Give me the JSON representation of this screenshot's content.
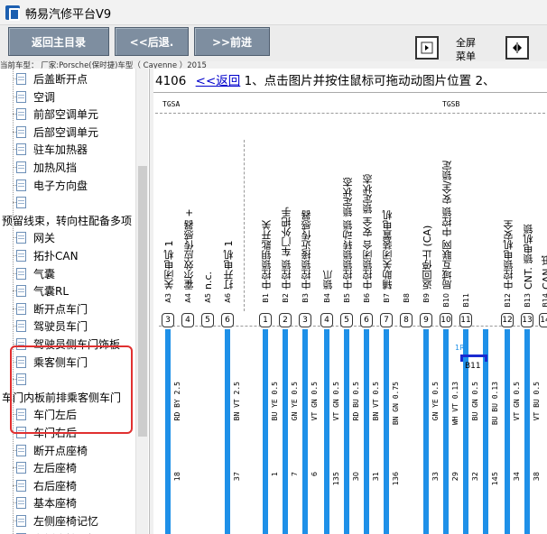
{
  "window": {
    "title": "畅易汽修平台V9"
  },
  "toolbar": {
    "back_main_label": "返回主目录",
    "prev_label": "<<后退.",
    "next_label": ">>前进",
    "fullscreen_label": "全屏",
    "menu_label": "菜单"
  },
  "car_info": "当前车型：  厂家:Porsche(保时捷)车型（ Cayenne ）2015",
  "tree": {
    "items": [
      {
        "label": "后盖断开点",
        "level": 1
      },
      {
        "label": "空调",
        "level": 1
      },
      {
        "label": "前部空调单元",
        "level": 1
      },
      {
        "label": "后部空调单元",
        "level": 1
      },
      {
        "label": "驻车加热器",
        "level": 1
      },
      {
        "label": "加热风挡",
        "level": 1
      },
      {
        "label": "电子方向盘",
        "level": 1
      },
      {
        "label": "",
        "level": 1
      },
      {
        "label": "预留线束，转向柱配备多项",
        "level": 0
      },
      {
        "label": "网关",
        "level": 1
      },
      {
        "label": "拓扑CAN",
        "level": 1
      },
      {
        "label": "气囊",
        "level": 1
      },
      {
        "label": "气囊RL",
        "level": 1
      },
      {
        "label": "断开点车门",
        "level": 1
      },
      {
        "label": "驾驶员车门",
        "level": 1
      },
      {
        "label": "驾驶员侧车门饰板",
        "level": 1
      },
      {
        "label": "乘客侧车门",
        "level": 1
      },
      {
        "label": "",
        "level": 1
      },
      {
        "label": "车门内板前排乘客侧车门",
        "level": 0
      },
      {
        "label": "车门左后",
        "level": 1
      },
      {
        "label": "车门右后",
        "level": 1
      },
      {
        "label": "断开点座椅",
        "level": 1
      },
      {
        "label": "左后座椅",
        "level": 1
      },
      {
        "label": "右后座椅",
        "level": 1
      },
      {
        "label": "基本座椅",
        "level": 1
      },
      {
        "label": "左侧座椅记忆",
        "level": 1
      },
      {
        "label": "右侧座椅记忆",
        "level": 1
      }
    ]
  },
  "content": {
    "page_number": "4106",
    "back_link": "<<返回",
    "instruction": "1、点击图片并按住鼠标可拖动动图片位置 2、"
  },
  "diagram": {
    "group_labels": [
      "TGSA",
      "TGSB"
    ],
    "columns": [
      {
        "func": "关闭电机 1",
        "pin": "A3",
        "box": "3",
        "wire": "RD BY 2.5",
        "num": "18"
      },
      {
        "func": "霍尔效应传感器 +",
        "pin": "A4",
        "box": "4",
        "wire": "",
        "num": ""
      },
      {
        "func": "n.c.",
        "pin": "A5",
        "box": "5",
        "wire": "",
        "num": ""
      },
      {
        "func": "打开电机 1",
        "pin": "A6",
        "box": "6",
        "wire": "BN VT 2.5",
        "num": "37"
      },
      {
        "func": "中控锁钥匙开关",
        "pin": "B1",
        "box": "1",
        "wire": "BU YE 0.5",
        "num": "1"
      },
      {
        "func": "中控锁 车门外把手",
        "pin": "B2",
        "box": "2",
        "wire": "GN YE 0.5",
        "num": "7"
      },
      {
        "func": "中控锁接近传感器",
        "pin": "B3",
        "box": "3",
        "wire": "VT GN 0.5",
        "num": "6"
      },
      {
        "func": "锁爪",
        "pin": "B4",
        "box": "4",
        "wire": "VT GN 0.5",
        "num": "135"
      },
      {
        "func": "中控锁锁转动锁 锁定状态",
        "pin": "B5",
        "box": "5",
        "wire": "RD BU 0.5",
        "num": "30"
      },
      {
        "func": "中控锁闭合 安全 锁定状态",
        "pin": "B6",
        "box": "6",
        "wire": "BN VT 0.5",
        "num": "31"
      },
      {
        "func": "辅助关闭装置电机",
        "pin": "B7",
        "box": "7",
        "wire": "BN GN 0.75",
        "num": "136"
      },
      {
        "func": "",
        "pin": "B8",
        "box": "8",
        "wire": "",
        "num": ""
      },
      {
        "func": "返回停止 (CA)",
        "pin": "B9",
        "box": "9",
        "wire": "GN YE 0.5",
        "num": "33"
      },
      {
        "func": "局域互联网 中控锁 安全/锁定",
        "pin": "B10",
        "box": "10",
        "wire": "WH VT 0.13",
        "num": "29"
      },
      {
        "func": "",
        "pin": "B11",
        "box": "11",
        "wire": "BU GN 0.5",
        "num": "32"
      },
      {
        "func": "",
        "pin": "",
        "box": "",
        "wire": "BU BU 0.13",
        "num": "145"
      },
      {
        "func": "中控锁电机安全",
        "pin": "B12",
        "box": "12",
        "wire": "VT GN 0.5",
        "num": "34"
      },
      {
        "func": "CNT. 锁电机锁",
        "pin": "B13",
        "box": "13",
        "wire": "VT BU 0.5",
        "num": "38"
      },
      {
        "func": "CAN 低",
        "pin": "B14",
        "box": "14",
        "wire": "",
        "num": ""
      }
    ],
    "mid_label": "B11",
    "mid_label2": "1R"
  }
}
